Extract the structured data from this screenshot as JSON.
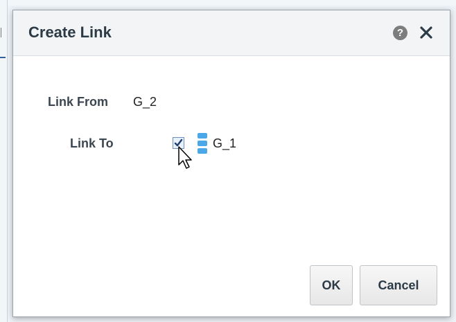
{
  "dialog": {
    "title": "Create Link",
    "help_icon_glyph": "?",
    "close_icon": "close-icon"
  },
  "form": {
    "link_from_label": "Link From",
    "link_from_value": "G_2",
    "link_to_label": "Link To",
    "link_to_item": "G_1",
    "link_to_checked": true,
    "link_to_icon": "database-icon"
  },
  "buttons": {
    "ok_label": "OK",
    "cancel_label": "Cancel"
  },
  "colors": {
    "database_icon": "#4aa8e8",
    "checkbox_fill": "#e7f0fb",
    "checkbox_check": "#1f3f73"
  }
}
